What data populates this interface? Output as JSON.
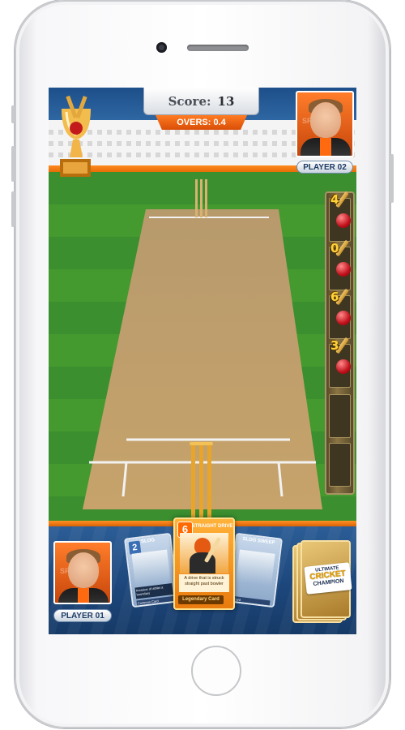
{
  "scoreboard": {
    "score_label": "Score:",
    "score_value": "13",
    "overs_label": "OVERS: 0.4"
  },
  "players": {
    "player1_name": "PLAYER 01",
    "player2_name": "PLAYER 02"
  },
  "ball_log": [
    {
      "runs": "4"
    },
    {
      "runs": "0"
    },
    {
      "runs": "6"
    },
    {
      "runs": "3"
    },
    {
      "runs": ""
    },
    {
      "runs": ""
    }
  ],
  "hand": {
    "left_card": {
      "cost": "2",
      "caption": "SLOG",
      "desc": "Invasion of athlet a boundary",
      "footer": "Common Card"
    },
    "right_card": {
      "caption": "SLOG SWEEP",
      "footer": "Card"
    },
    "selected_card": {
      "cost": "6",
      "title": "STRAIGHT DRIVE",
      "desc": "A drive that is struck straight past bowler",
      "rarity": "Legendary Card"
    }
  },
  "deck": {
    "line1": "ULTIMATE",
    "line2": "CRICKET",
    "line3": "CHAMPION"
  },
  "colors": {
    "accent_orange": "#e8680a",
    "panel_blue": "#1d477c",
    "gold": "#e9c777"
  }
}
